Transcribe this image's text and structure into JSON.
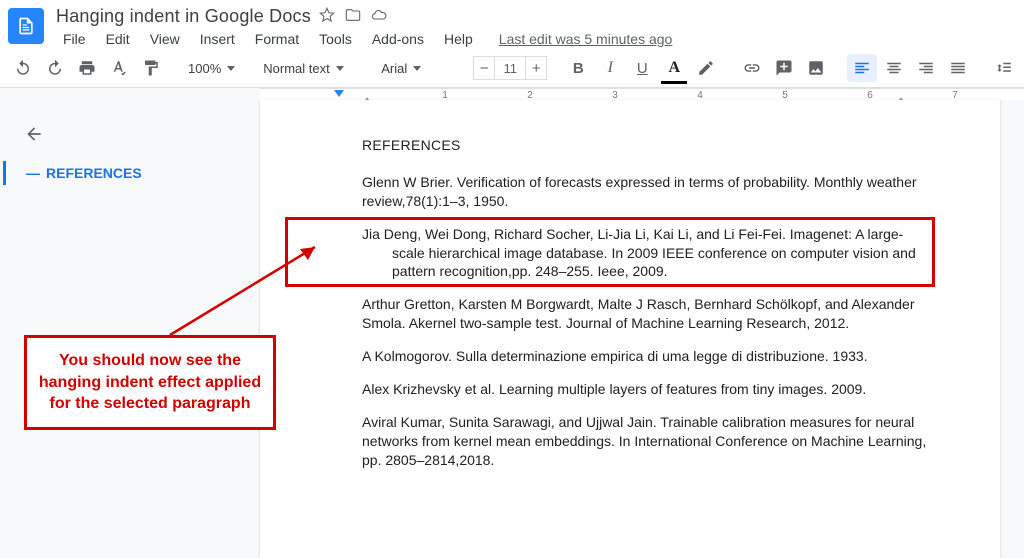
{
  "header": {
    "doc_title": "Hanging indent in Google Docs",
    "menus": [
      "File",
      "Edit",
      "View",
      "Insert",
      "Format",
      "Tools",
      "Add-ons",
      "Help"
    ],
    "last_edit": "Last edit was 5 minutes ago"
  },
  "toolbar": {
    "zoom": "100%",
    "style": "Normal text",
    "font": "Arial",
    "font_size": "11",
    "bold_letter": "B",
    "italic_letter": "I",
    "underline_letter": "U",
    "color_letter": "A"
  },
  "ruler": {
    "numbers": [
      "1",
      "2",
      "3",
      "4",
      "5",
      "6",
      "7"
    ]
  },
  "outline": {
    "item": "REFERENCES"
  },
  "document": {
    "heading": "REFERENCES",
    "refs": [
      "Glenn W Brier. Verification of forecasts expressed in terms of probability. Monthly weather review,78(1):1–3, 1950.",
      "Jia Deng, Wei Dong, Richard Socher, Li-Jia Li, Kai Li, and Li Fei-Fei. Imagenet: A large-scale hierarchical image database. In 2009 IEEE conference on computer vision and pattern recognition,pp. 248–255. Ieee, 2009.",
      "Arthur Gretton, Karsten M Borgwardt, Malte J Rasch, Bernhard Schölkopf, and Alexander Smola. Akernel two-sample test. Journal of Machine Learning Research, 2012.",
      "A Kolmogorov. Sulla determinazione empirica di uma legge di distribuzione. 1933.",
      "Alex Krizhevsky et al. Learning multiple layers of features from tiny images. 2009.",
      "Aviral Kumar, Sunita Sarawagi, and Ujjwal Jain. Trainable calibration measures for neural networks from kernel mean embeddings. In International Conference on Machine Learning, pp. 2805–2814,2018."
    ]
  },
  "annotation": {
    "text": "You should now see the hanging indent effect applied for the selected paragraph"
  }
}
